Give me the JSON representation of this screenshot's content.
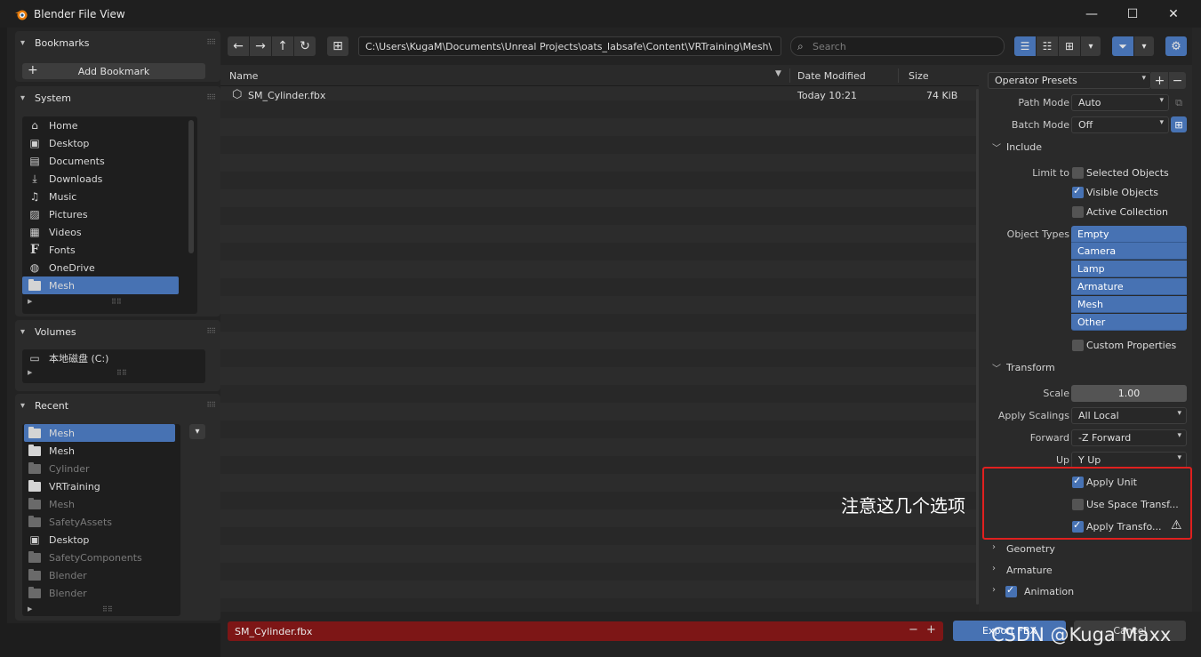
{
  "window": {
    "title": "Blender File View",
    "controls": [
      "—",
      "☐",
      "✕"
    ]
  },
  "bookmarks": {
    "header": "Bookmarks",
    "add_label": "Add Bookmark"
  },
  "system": {
    "header": "System",
    "items": [
      {
        "label": "Home",
        "icon": "home-icon"
      },
      {
        "label": "Desktop",
        "icon": "desktop-icon"
      },
      {
        "label": "Documents",
        "icon": "documents-icon"
      },
      {
        "label": "Downloads",
        "icon": "downloads-icon"
      },
      {
        "label": "Music",
        "icon": "music-icon"
      },
      {
        "label": "Pictures",
        "icon": "pictures-icon"
      },
      {
        "label": "Videos",
        "icon": "videos-icon"
      },
      {
        "label": "Fonts",
        "icon": "fonts-icon"
      },
      {
        "label": "OneDrive",
        "icon": "globe-icon"
      },
      {
        "label": "Mesh",
        "icon": "folder-icon",
        "selected": true
      }
    ]
  },
  "volumes": {
    "header": "Volumes",
    "items": [
      {
        "label": "本地磁盘 (C:)",
        "icon": "disk-icon"
      }
    ]
  },
  "recent": {
    "header": "Recent",
    "items": [
      {
        "label": "Mesh",
        "selected": true,
        "dim": false
      },
      {
        "label": "Mesh",
        "dim": false
      },
      {
        "label": "Cylinder",
        "dim": true
      },
      {
        "label": "VRTraining",
        "dim": false
      },
      {
        "label": "Mesh",
        "dim": true
      },
      {
        "label": "SafetyAssets",
        "dim": true
      },
      {
        "label": "Desktop",
        "dim": false
      },
      {
        "label": "SafetyComponents",
        "dim": true
      },
      {
        "label": "Blender",
        "dim": true
      },
      {
        "label": "Blender",
        "dim": true
      }
    ]
  },
  "toolbar": {
    "path": "C:\\Users\\KugaM\\Documents\\Unreal Projects\\oats_labsafe\\Content\\VRTraining\\Mesh\\",
    "search_placeholder": "Search"
  },
  "filelist": {
    "columns": {
      "name": "Name",
      "date": "Date Modified",
      "size": "Size"
    },
    "files": [
      {
        "name": "SM_Cylinder.fbx",
        "date": "Today 10:21",
        "size": "74 KiB"
      }
    ]
  },
  "properties": {
    "operator_presets": "Operator Presets",
    "path_mode": {
      "label": "Path Mode",
      "value": "Auto"
    },
    "batch_mode": {
      "label": "Batch Mode",
      "value": "Off"
    },
    "include": {
      "header": "Include",
      "limit_to_label": "Limit to",
      "selected_objects": {
        "label": "Selected Objects",
        "checked": false
      },
      "visible_objects": {
        "label": "Visible Objects",
        "checked": true
      },
      "active_collection": {
        "label": "Active Collection",
        "checked": false
      },
      "object_types_label": "Object Types",
      "object_types": [
        "Empty",
        "Camera",
        "Lamp",
        "Armature",
        "Mesh",
        "Other"
      ],
      "custom_properties": {
        "label": "Custom Properties",
        "checked": false
      }
    },
    "transform": {
      "header": "Transform",
      "scale": {
        "label": "Scale",
        "value": "1.00"
      },
      "apply_scalings": {
        "label": "Apply Scalings",
        "value": "All Local"
      },
      "forward": {
        "label": "Forward",
        "value": "-Z Forward"
      },
      "up": {
        "label": "Up",
        "value": "Y Up"
      },
      "apply_unit": {
        "label": "Apply Unit",
        "checked": true
      },
      "use_space_transform": {
        "label": "Use Space Transf...",
        "checked": false
      },
      "apply_transform": {
        "label": "Apply Transfo...",
        "checked": true
      }
    },
    "geometry": {
      "header": "Geometry"
    },
    "armature": {
      "header": "Armature"
    },
    "animation": {
      "header": "Animation",
      "checked": true
    }
  },
  "annotation": "注意这几个选项",
  "bottom": {
    "filename": "SM_Cylinder.fbx",
    "export_label": "Export FBX",
    "cancel_label": "Cancel"
  },
  "watermark": "CSDN @Kuga Maxx",
  "colors": {
    "accent": "#4772b3",
    "error_field": "#7d1616",
    "highlight_box": "#e0201f"
  }
}
